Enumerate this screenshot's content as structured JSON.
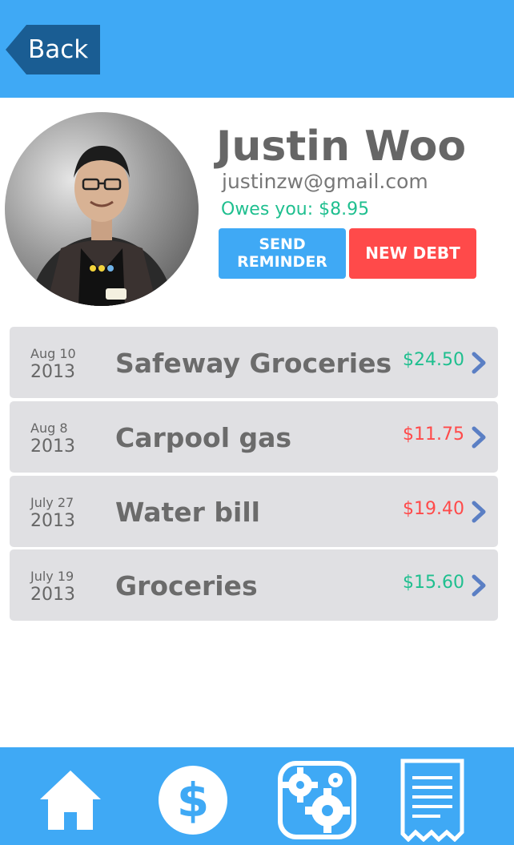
{
  "header": {
    "back_label": "Back"
  },
  "profile": {
    "name": "Justin Woo",
    "email": "justinzw@gmail.com",
    "owes_text": "Owes you: $8.95"
  },
  "actions": {
    "send_reminder_line1": "SEND",
    "send_reminder_line2": "REMINDER",
    "new_debt": "NEW DEBT"
  },
  "debts": [
    {
      "month_day": "Aug 10",
      "year": "2013",
      "title": "Safeway Groceries",
      "amount": "$24.50",
      "status_color": "#1fbf8f"
    },
    {
      "month_day": "Aug  8",
      "year": "2013",
      "title": "Carpool gas",
      "amount": "$11.75",
      "status_color": "#ff4a4a"
    },
    {
      "month_day": "July 27",
      "year": "2013",
      "title": "Water bill",
      "amount": "$19.40",
      "status_color": "#ff4a4a"
    },
    {
      "month_day": "July 19",
      "year": "2013",
      "title": "Groceries",
      "amount": "$15.60",
      "status_color": "#1fbf8f"
    }
  ],
  "colors": {
    "brand_blue": "#3fa9f5",
    "back_blue": "#1a5d93",
    "positive_green": "#1fbf8f",
    "negative_red": "#ff4a4a",
    "chevron_blue": "#5b7fc4"
  },
  "bottom_nav": [
    {
      "icon": "home-icon"
    },
    {
      "icon": "dollar-icon"
    },
    {
      "icon": "gears-icon"
    },
    {
      "icon": "receipt-icon"
    }
  ]
}
